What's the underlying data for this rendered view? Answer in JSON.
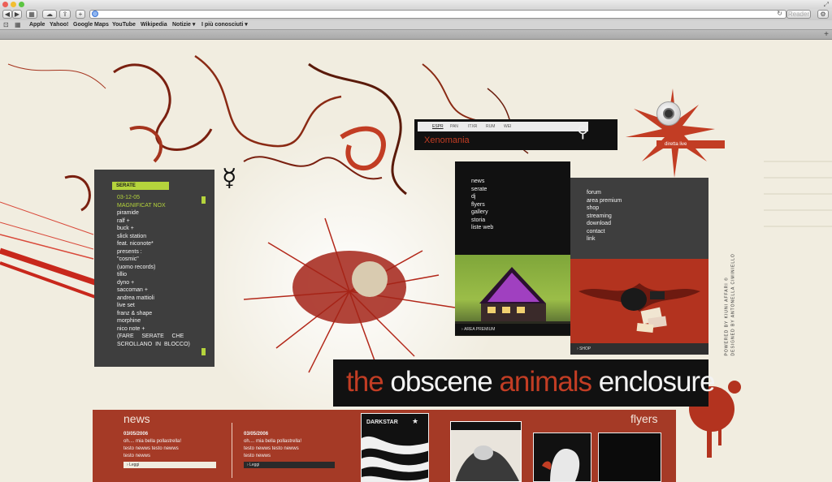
{
  "browser": {
    "reader_label": "Reader",
    "bookmarks": [
      "Apple",
      "Yahoo!",
      "Google Maps",
      "YouTube",
      "Wikipedia",
      "Notizie ▾",
      "I più conosciuti ▾"
    ]
  },
  "site": {
    "lang_options": [
      "ESPR",
      "PAN",
      "ITXR",
      "RUM",
      "WEI"
    ],
    "banner_label": "Xenomania",
    "webcam_label": "diretta live",
    "serate": {
      "header": "SERATE",
      "date": "03-12-05",
      "highlight": "MAGNIFICAT NOX",
      "items": [
        "piramide",
        "ralf +",
        "buck +",
        "slick station",
        "feat. niconote*",
        "presents :",
        "\"cosmic\"",
        "(uomo records)",
        "tillio",
        "dyno +",
        "saccoman +",
        "andrea mattioli",
        "live set",
        "franz & shape",
        "morphine",
        "nico note +",
        "(FARE     SERATE     CHE",
        "SCROLLANO  IN  BLOCCO)"
      ]
    },
    "menu_left": [
      "news",
      "serate",
      "dj",
      "flyers",
      "gallery",
      "storia",
      "liste web"
    ],
    "area_premium_label": "AREA PREMIUM",
    "menu_right": [
      "forum",
      "area premium",
      "shop",
      "streaming",
      "download",
      "contact",
      "link"
    ],
    "shop_label": "SHOP",
    "credits": [
      "POWERED BY KIUNI AFFARI ©",
      "DESIGNED BY ANTONELLA CIMINIELLO"
    ],
    "title_parts": [
      "the",
      "obscene",
      "animals",
      "enclosure"
    ],
    "news_title": "news",
    "flyers_title": "flyers",
    "news": [
      {
        "date": "03/05/2006",
        "text1": "oh.... mia bella pollastrella!",
        "text2": "testo newws testo newws",
        "text3": "testo newws",
        "read": "Leggi"
      },
      {
        "date": "03/05/2006",
        "text1": "oh.... mia bella pollastrella!",
        "text2": "testo newws testo newws",
        "text3": "testo newws",
        "read": "Leggi"
      }
    ],
    "flyer_labels": [
      "DARKSTAR"
    ],
    "colors": {
      "red": "#a53a26",
      "dark": "#3e3e3e",
      "lime": "#b5d43c",
      "black": "#111111",
      "paper": "#f1ede0"
    }
  }
}
